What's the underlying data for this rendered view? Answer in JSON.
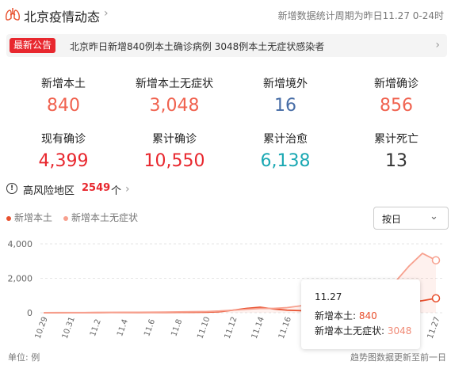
{
  "header": {
    "title": "北京疫情动态",
    "period": "新增数据统计周期为昨日11.27 0-24时"
  },
  "notice": {
    "badge": "最新公告",
    "text": "北京昨日新增840例本土确诊病例 3048例本土无症状感染者"
  },
  "stats": [
    {
      "label": "新增本土",
      "value": "840",
      "color": "#f0624f"
    },
    {
      "label": "新增本土无症状",
      "value": "3,048",
      "color": "#f0624f"
    },
    {
      "label": "新增境外",
      "value": "16",
      "color": "#476da6"
    },
    {
      "label": "新增确诊",
      "value": "856",
      "color": "#f0624f"
    },
    {
      "label": "现有确诊",
      "value": "4,399",
      "color": "#e8272e"
    },
    {
      "label": "累计确诊",
      "value": "10,550",
      "color": "#e8272e"
    },
    {
      "label": "累计治愈",
      "value": "6,138",
      "color": "#1aa8b3"
    },
    {
      "label": "累计死亡",
      "value": "13",
      "color": "#333333"
    }
  ],
  "risk": {
    "label": "高风险地区",
    "count": "2549",
    "unit": "个"
  },
  "select": {
    "label": "按日"
  },
  "tooltip": {
    "date": "11.27",
    "row1_label": "新增本土: ",
    "row1_value": "840",
    "row2_label": "新增本土无症状: ",
    "row2_value": "3048"
  },
  "footer": {
    "unit": "单位: 例",
    "note": "趋势图数据更新至前一日"
  },
  "chart_data": {
    "type": "line",
    "title": "",
    "xlabel": "",
    "ylabel": "",
    "ylim": [
      0,
      4000
    ],
    "yticks": [
      "0",
      "2,000",
      "4,000"
    ],
    "grid": true,
    "legend_position": "top-left",
    "tick_labels": [
      "10.29",
      "10.31",
      "11.2",
      "11.4",
      "11.6",
      "11.8",
      "11.10",
      "11.12",
      "11.14",
      "11.16",
      "11.18",
      "11.20",
      "11.22",
      "11.24",
      "11.27"
    ],
    "x": [
      "10.29",
      "10.30",
      "10.31",
      "11.1",
      "11.2",
      "11.3",
      "11.4",
      "11.5",
      "11.6",
      "11.7",
      "11.8",
      "11.9",
      "11.10",
      "11.11",
      "11.12",
      "11.13",
      "11.14",
      "11.15",
      "11.16",
      "11.17",
      "11.18",
      "11.19",
      "11.20",
      "11.21",
      "11.22",
      "11.23",
      "11.24",
      "11.25",
      "11.26",
      "11.27"
    ],
    "series": [
      {
        "name": "新增本土",
        "color": "#e8502e",
        "values": [
          2,
          3,
          5,
          6,
          8,
          10,
          12,
          15,
          18,
          20,
          22,
          25,
          30,
          60,
          150,
          250,
          320,
          220,
          150,
          120,
          100,
          90,
          100,
          130,
          200,
          300,
          450,
          600,
          700,
          840
        ]
      },
      {
        "name": "新增本土无症状",
        "color": "#f7a08e",
        "values": [
          5,
          8,
          10,
          12,
          15,
          20,
          25,
          30,
          35,
          40,
          50,
          60,
          70,
          100,
          150,
          200,
          250,
          250,
          300,
          400,
          700,
          800,
          900,
          1000,
          1300,
          1600,
          1800,
          2700,
          3450,
          3048
        ]
      }
    ]
  }
}
